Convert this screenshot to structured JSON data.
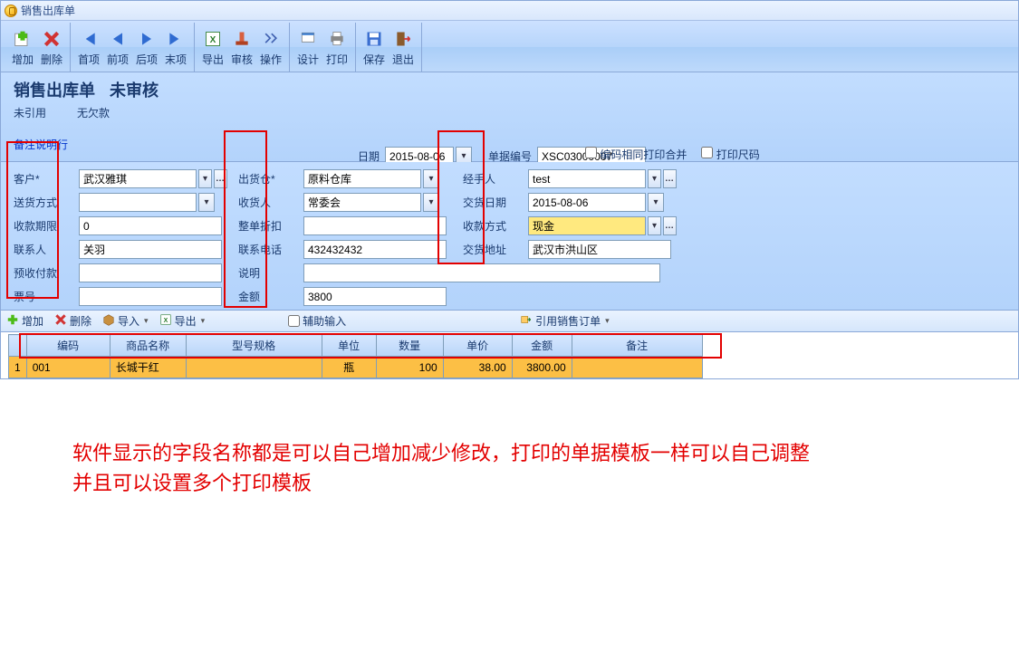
{
  "window": {
    "title": "销售出库单"
  },
  "toolbar": {
    "add": "增加",
    "del": "删除",
    "first": "首项",
    "prev": "前项",
    "next": "后项",
    "last": "末项",
    "export": "导出",
    "audit": "审核",
    "operate": "操作",
    "design": "设计",
    "print": "打印",
    "save": "保存",
    "exit": "退出"
  },
  "header": {
    "doc_title": "销售出库单",
    "status": "未审核",
    "unref": "未引用",
    "no_debt": "无欠款",
    "date_label": "日期",
    "date_value": "2015-08-06",
    "docno_label": "单据编号",
    "docno_value": "XSC03000007",
    "merge_label": "编码相同打印合并",
    "print_size_label": "打印尺码",
    "remark_link": "备注说明行"
  },
  "form": {
    "labels": {
      "customer": "客户*",
      "warehouse": "出货仓*",
      "handler": "经手人",
      "delivery_method": "送货方式",
      "receiver": "收货人",
      "delivery_date": "交货日期",
      "pay_period": "收款期限",
      "discount": "整单折扣",
      "pay_method": "收款方式",
      "contact": "联系人",
      "phone": "联系电话",
      "delivery_addr": "交货地址",
      "prepaid": "预收付款",
      "description": "说明",
      "ticket": "票号",
      "amount": "金额"
    },
    "values": {
      "customer": "武汉雅琪",
      "warehouse": "原料仓库",
      "handler": "test",
      "delivery_method": "",
      "receiver": "常委会",
      "delivery_date": "2015-08-06",
      "pay_period": "0",
      "discount": "",
      "pay_method": "现金",
      "contact": "关羽",
      "phone": "432432432",
      "delivery_addr": "武汉市洪山区",
      "prepaid": "",
      "description": "",
      "ticket": "",
      "amount": "3800"
    }
  },
  "grid_toolbar": {
    "add": "增加",
    "del": "删除",
    "import": "导入",
    "export": "导出",
    "assist": "辅助输入",
    "quote": "引用销售订单"
  },
  "table": {
    "headers": [
      "编码",
      "商品名称",
      "型号规格",
      "单位",
      "数量",
      "单价",
      "金额",
      "备注"
    ],
    "rows": [
      {
        "n": "1",
        "code": "001",
        "name": "长城干红",
        "spec": "",
        "unit": "瓶",
        "qty": "100",
        "price": "38.00",
        "amount": "3800.00",
        "note": ""
      }
    ]
  },
  "annotation": {
    "line1": "软件显示的字段名称都是可以自己增加减少修改，打印的单据模板一样可以自己调整",
    "line2": "并且可以设置多个打印模板"
  }
}
